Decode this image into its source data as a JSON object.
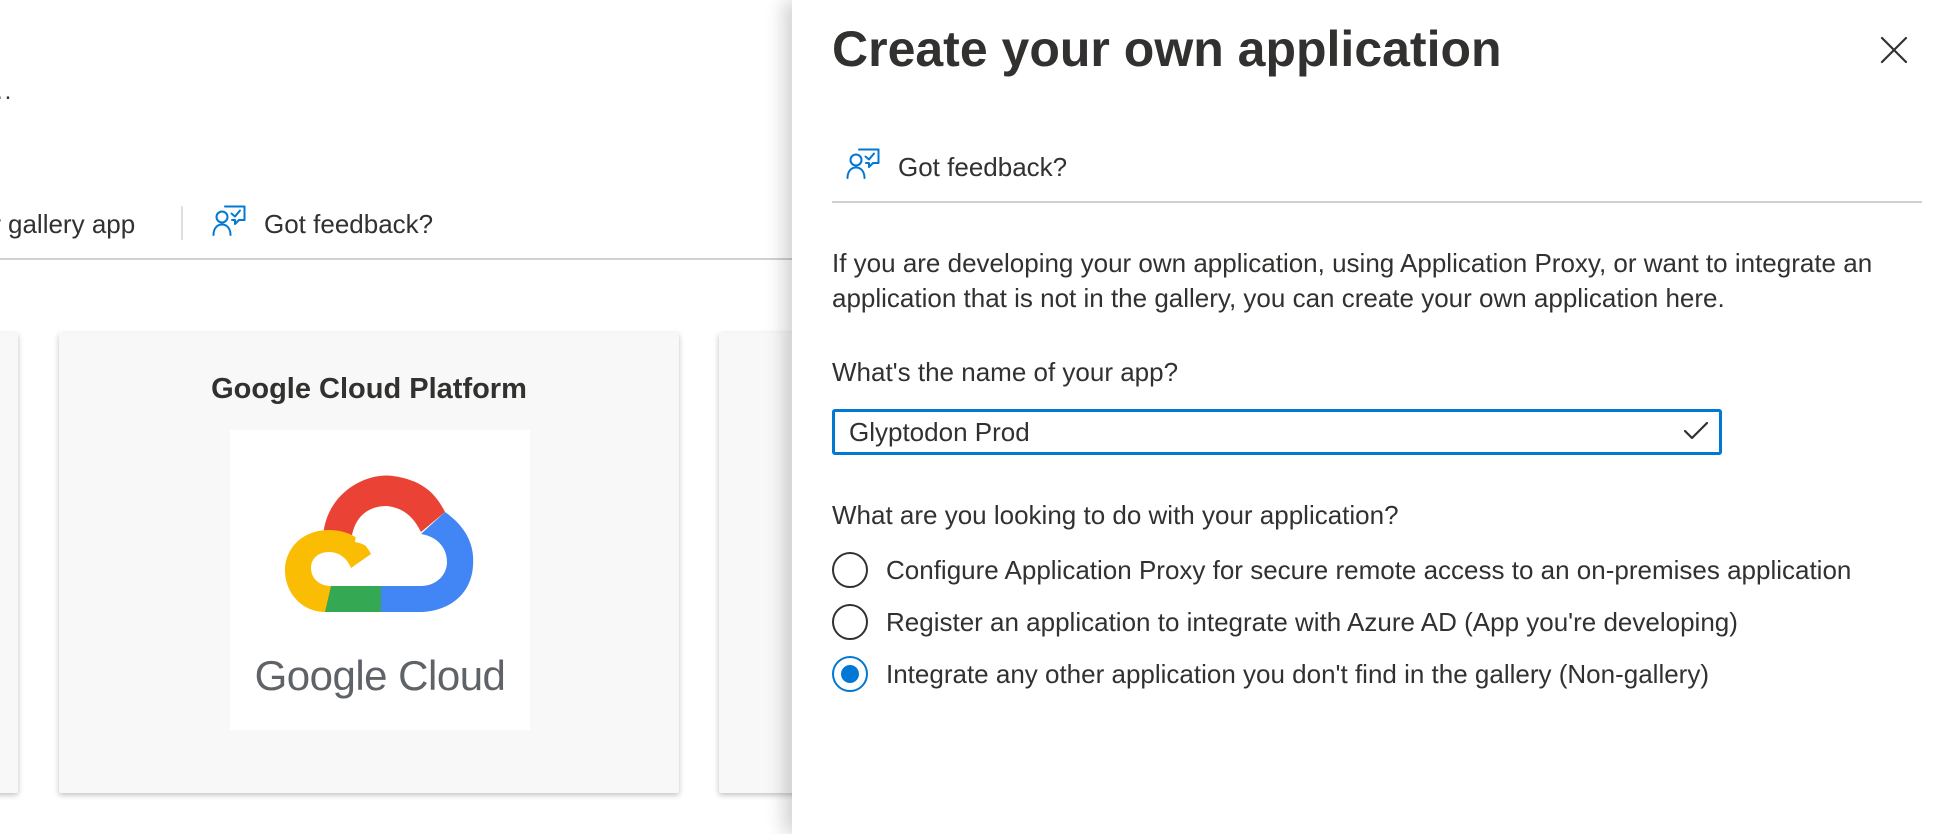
{
  "colors": {
    "accent": "#0078d4",
    "text": "#323130",
    "divider": "#d2d0ce",
    "tile_bg": "#f8f8f8"
  },
  "background": {
    "breadcrumb_ellipsis": "..",
    "toolbar": {
      "gallery_label": "w gallery app",
      "feedback_label": "Got feedback?",
      "feedback_icon": "person-feedback-icon"
    },
    "tiles": [
      {
        "title": "Google Cloud Platform",
        "logo_icon": "google-cloud-logo",
        "logo_wordmark": "Google Cloud"
      }
    ]
  },
  "panel": {
    "title": "Create your own application",
    "close_icon": "close-icon",
    "feedback_label": "Got feedback?",
    "feedback_icon": "person-feedback-icon",
    "description": "If you are developing your own application, using Application Proxy, or want to integrate an application that is not in the gallery, you can create your own application here.",
    "name_field": {
      "label": "What's the name of your app?",
      "value": "Glyptodon Prod",
      "valid_icon": "checkmark-icon"
    },
    "purpose": {
      "label": "What are you looking to do with your application?",
      "options": [
        {
          "label": "Configure Application Proxy for secure remote access to an on-premises application",
          "selected": false
        },
        {
          "label": "Register an application to integrate with Azure AD (App you're developing)",
          "selected": false
        },
        {
          "label": "Integrate any other application you don't find in the gallery (Non-gallery)",
          "selected": true
        }
      ]
    }
  }
}
